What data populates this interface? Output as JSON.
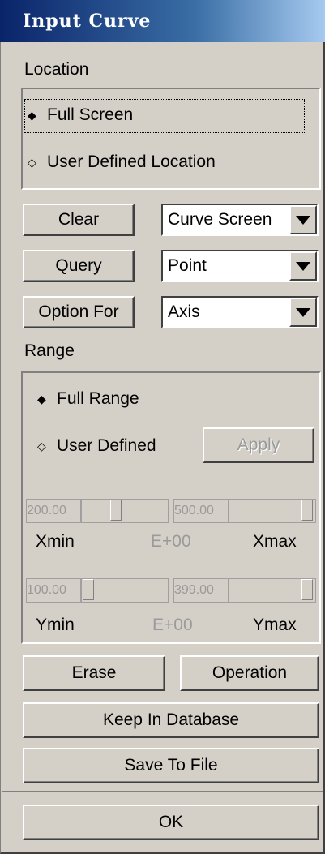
{
  "window": {
    "title": "Input Curve"
  },
  "location": {
    "label": "Location",
    "options": [
      {
        "label": "Full Screen",
        "selected": true
      },
      {
        "label": "User Defined Location",
        "selected": false
      }
    ]
  },
  "actions": {
    "clear_label": "Clear",
    "query_label": "Query",
    "option_for_label": "Option For"
  },
  "selects": {
    "clear_target": "Curve Screen",
    "query_target": "Point",
    "option_target": "Axis"
  },
  "range": {
    "label": "Range",
    "full_range_label": "Full Range",
    "user_defined_label": "User Defined",
    "apply_label": "Apply",
    "x": {
      "min_value": "200.00",
      "max_value": "500.00",
      "min_label": "Xmin",
      "exponent": "E+00",
      "max_label": "Xmax"
    },
    "y": {
      "min_value": "100.00",
      "max_value": "399.00",
      "min_label": "Ymin",
      "exponent": "E+00",
      "max_label": "Ymax"
    }
  },
  "bottom": {
    "erase_label": "Erase",
    "operation_label": "Operation",
    "keep_label": "Keep In Database",
    "save_label": "Save To File",
    "ok_label": "OK"
  },
  "colors": {
    "face": "#d4d0c8",
    "title_bar_start": "#0a246a",
    "title_bar_end": "#a6caf0",
    "disabled_text": "#9a9a9a"
  },
  "icons": {
    "selected_radio": "filled-diamond",
    "unselected_radio": "hollow-diamond",
    "dropdown": "down-triangle"
  }
}
